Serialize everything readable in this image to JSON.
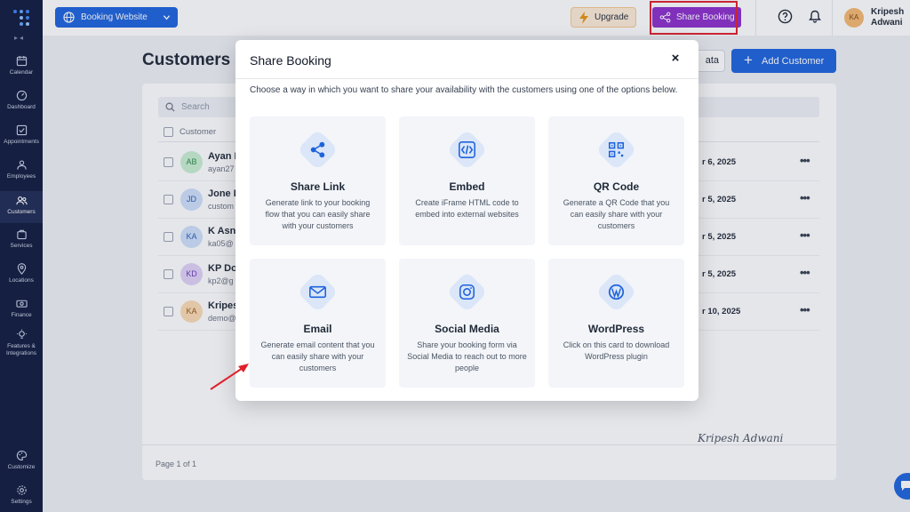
{
  "sidebar": {
    "items": [
      {
        "label": "Calendar",
        "icon": "calendar-icon"
      },
      {
        "label": "Dashboard",
        "icon": "dashboard-icon"
      },
      {
        "label": "Appointments",
        "icon": "appointments-icon"
      },
      {
        "label": "Employees",
        "icon": "employees-icon"
      },
      {
        "label": "Customers",
        "icon": "customers-icon"
      },
      {
        "label": "Services",
        "icon": "services-icon"
      },
      {
        "label": "Locations",
        "icon": "location-pin-icon"
      },
      {
        "label": "Finance",
        "icon": "finance-icon"
      },
      {
        "label": "Features & Integrations",
        "icon": "lightbulb-icon"
      }
    ],
    "bottom": [
      {
        "label": "Customize",
        "icon": "palette-icon"
      },
      {
        "label": "Settings",
        "icon": "gear-icon"
      }
    ],
    "active": "Customers"
  },
  "topbar": {
    "site_selector": "Booking Website",
    "upgrade_label": "Upgrade",
    "share_label": "Share Booking",
    "user_initials": "KA",
    "user_name": "Kripesh Adwani"
  },
  "page": {
    "title": "Customers (",
    "data_button": "ata",
    "add_button": "Add Customer",
    "search_placeholder": "Search",
    "column_customer": "Customer",
    "rows": [
      {
        "initials": "AB",
        "name": "Ayan B",
        "email": "ayan27",
        "date": "r 6, 2025",
        "avatar_color": "#c9efd2",
        "avatar_text": "#2f8a47"
      },
      {
        "initials": "JD",
        "name": "Jone D",
        "email": "custom",
        "date": "r 5, 2025",
        "avatar_color": "#cfe0fa",
        "avatar_text": "#2c5fb8"
      },
      {
        "initials": "KA",
        "name": "K Asna",
        "email": "ka05@",
        "date": "r 5, 2025",
        "avatar_color": "#cfe0fa",
        "avatar_text": "#2c5fb8"
      },
      {
        "initials": "KD",
        "name": "KP Do",
        "email": "kp2@g",
        "date": "r 5, 2025",
        "avatar_color": "#e1d3f7",
        "avatar_text": "#6b3fb4"
      },
      {
        "initials": "KA",
        "name": "Kripes",
        "email": "demo@",
        "date": "r 10, 2025",
        "avatar_color": "#fbdcb4",
        "avatar_text": "#9a5a16"
      }
    ],
    "pager": "Page 1 of 1",
    "signature": "Kripesh Adwani"
  },
  "modal": {
    "title": "Share Booking",
    "close": "×",
    "description": "Choose a way in which you want to share your availability with the customers using one of the options below.",
    "options": [
      {
        "title": "Share Link",
        "desc": "Generate link to your booking flow that you can easily share with your customers",
        "icon": "share-link-icon"
      },
      {
        "title": "Embed",
        "desc": "Create iFrame HTML code to embed into external websites",
        "icon": "code-icon"
      },
      {
        "title": "QR Code",
        "desc": "Generate a QR Code that you can easily share with your customers",
        "icon": "qr-code-icon"
      },
      {
        "title": "Email",
        "desc": "Generate email content that you can easily share with your customers",
        "icon": "envelope-icon"
      },
      {
        "title": "Social Media",
        "desc": "Share your booking form via Social Media to reach out to more people",
        "icon": "instagram-icon"
      },
      {
        "title": "WordPress",
        "desc": "Click on this card to download WordPress plugin",
        "icon": "wordpress-icon"
      }
    ]
  },
  "colors": {
    "sidebar_bg": "#0f1b3d",
    "primary": "#1d63dc",
    "share_purple": "#8b2fc9",
    "highlight_red": "#e0212b",
    "upgrade_bg": "#fdecd6"
  }
}
